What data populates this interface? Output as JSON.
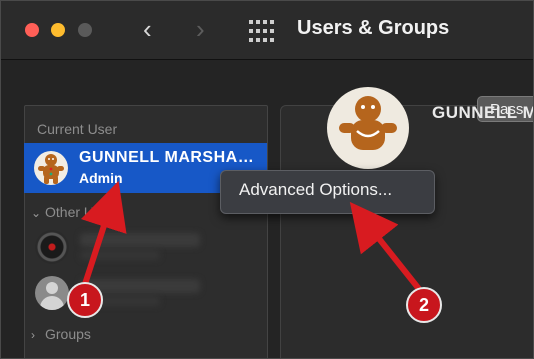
{
  "window": {
    "title": "Users & Groups",
    "back_glyph": "‹",
    "forward_glyph": "›",
    "grid_icon": "grid-icon"
  },
  "sidebar": {
    "current_user_label": "Current User",
    "current_user": {
      "name": "GUNNELL MARSHA…",
      "role": "Admin",
      "avatar": "gingerbread-avatar"
    },
    "other_users_label": "Other Users",
    "other_users": [
      {
        "avatar": "record-avatar"
      },
      {
        "avatar": "generic-person-avatar"
      }
    ],
    "groups_label": "Groups"
  },
  "detail": {
    "name": "GUNNELL M",
    "password_button": "Pass"
  },
  "context_menu": {
    "items": [
      "Advanced Options..."
    ]
  },
  "annotations": {
    "step1": "1",
    "step2": "2",
    "color": "#c8161d"
  },
  "colors": {
    "selection": "#1758c7",
    "close": "#ff5f57",
    "minimize": "#febc2e"
  }
}
